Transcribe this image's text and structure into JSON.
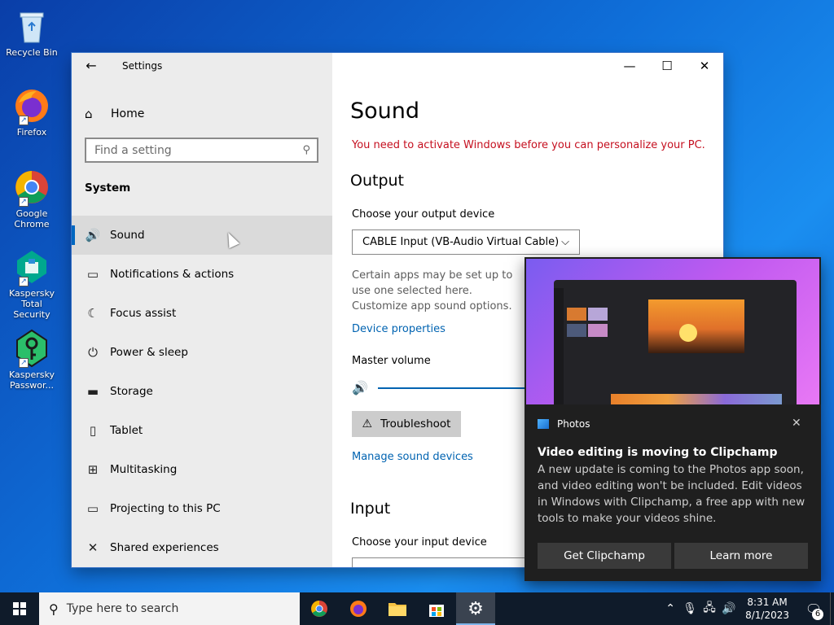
{
  "desktop": {
    "icons": [
      {
        "label": "Recycle Bin"
      },
      {
        "label": "Firefox"
      },
      {
        "label": "Google Chrome"
      },
      {
        "label": "Kaspersky Total Security"
      },
      {
        "label": "Kaspersky Passwor..."
      }
    ]
  },
  "window": {
    "title": "Settings",
    "back_glyph": "←",
    "minimize_glyph": "—",
    "maximize_glyph": "☐",
    "close_glyph": "✕"
  },
  "sidebar": {
    "home_label": "Home",
    "search_placeholder": "Find a setting",
    "section_label": "System",
    "items": [
      {
        "label": "Sound",
        "icon": "🔊",
        "active": true
      },
      {
        "label": "Notifications & actions",
        "icon": "▭"
      },
      {
        "label": "Focus assist",
        "icon": "☾"
      },
      {
        "label": "Power & sleep",
        "icon": "⏻"
      },
      {
        "label": "Storage",
        "icon": "▬"
      },
      {
        "label": "Tablet",
        "icon": "▯"
      },
      {
        "label": "Multitasking",
        "icon": "⊞"
      },
      {
        "label": "Projecting to this PC",
        "icon": "▭"
      },
      {
        "label": "Shared experiences",
        "icon": "✕"
      }
    ]
  },
  "content": {
    "title": "Sound",
    "activation_warning": "You need to activate Windows before you can personalize your PC.",
    "output_heading": "Output",
    "output_device_label": "Choose your output device",
    "output_device_value": "CABLE Input (VB-Audio Virtual Cable)",
    "output_desc": "Certain apps may be set up to use one selected here. Customize app sound options.",
    "device_properties_link": "Device properties",
    "master_volume_label": "Master volume",
    "troubleshoot_label": "Troubleshoot",
    "manage_devices_link": "Manage sound devices",
    "input_heading": "Input",
    "input_device_label": "Choose your input device"
  },
  "toast": {
    "app_name": "Photos",
    "title": "Video editing is moving to Clipchamp",
    "body": "A new update is coming to the Photos app soon, and video editing won't be included. Edit videos in Windows with Clipchamp, a free app with new tools to make your videos shine.",
    "primary_button": "Get Clipchamp",
    "secondary_button": "Learn more",
    "close_glyph": "✕"
  },
  "taskbar": {
    "search_placeholder": "Type here to search",
    "time": "8:31 AM",
    "date": "8/1/2023",
    "notification_count": "6"
  }
}
